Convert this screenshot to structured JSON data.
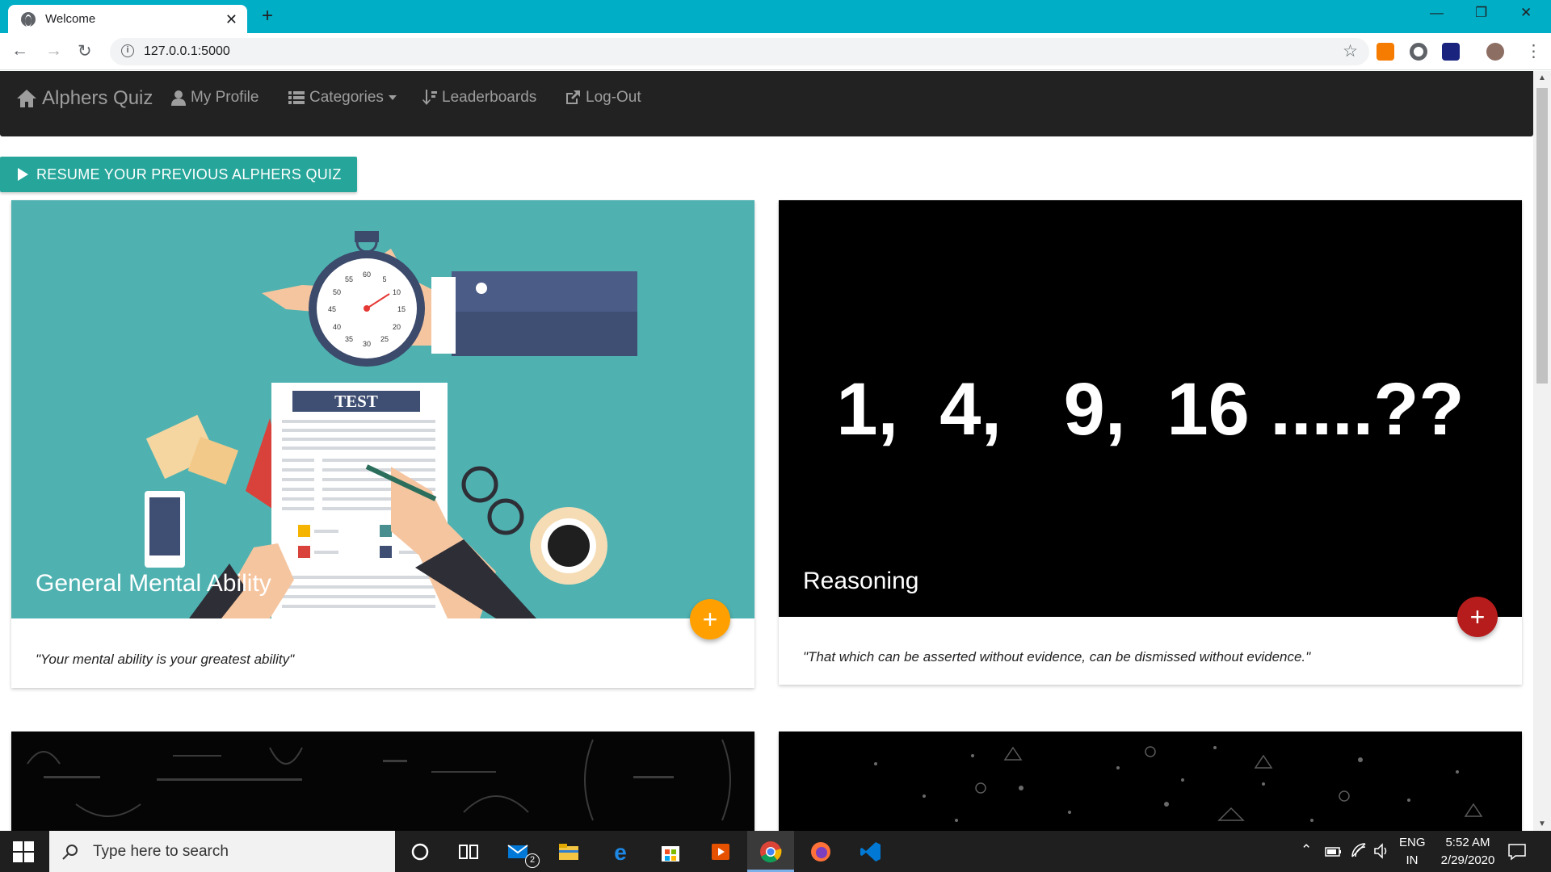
{
  "browser": {
    "tab_title": "Welcome",
    "url": "127.0.0.1:5000",
    "accent_color": "#00aec6"
  },
  "navbar": {
    "brand": "Alphers Quiz",
    "items": [
      {
        "label": "My Profile",
        "icon": "user-icon"
      },
      {
        "label": "Categories",
        "icon": "list-icon"
      },
      {
        "label": "Leaderboards",
        "icon": "sort-icon"
      },
      {
        "label": "Log-Out",
        "icon": "logout-icon"
      }
    ]
  },
  "resume_button": "RESUME YOUR PREVIOUS ALPHERS QUIZ",
  "cards": [
    {
      "title": "General Mental Ability",
      "quote": "\"Your mental ability is your greatest ability\"",
      "fab_color": "#ffa000",
      "image_text": "TEST",
      "stopwatch_numbers": [
        "60",
        "5",
        "10",
        "15",
        "20",
        "25",
        "30",
        "35",
        "40",
        "45",
        "50",
        "55"
      ]
    },
    {
      "title": "Reasoning",
      "quote": "\"That which can be asserted without evidence, can be dismissed without evidence.\"",
      "fab_color": "#b71c1c",
      "image_text": "1,  4,   9,  16 .....??"
    }
  ],
  "taskbar": {
    "search_placeholder": "Type here to search",
    "mail_badge": "2",
    "lang_top": "ENG",
    "lang_bottom": "IN",
    "time": "5:52 AM",
    "date": "2/29/2020"
  }
}
